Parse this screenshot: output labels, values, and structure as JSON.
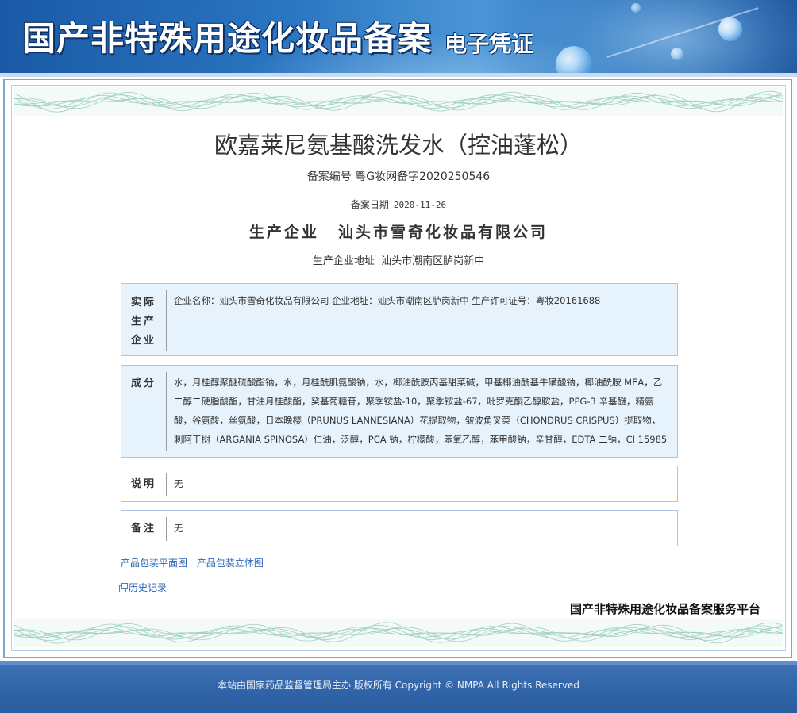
{
  "header": {
    "title": "国产非特殊用途化妆品备案",
    "subtitle": "电子凭证"
  },
  "product": {
    "name": "欧嘉莱尼氨基酸洗发水（控油蓬松）",
    "reg_no_label": "备案编号",
    "reg_no_value": "粤G妆网备字2020250546",
    "reg_date_label": "备案日期",
    "reg_date_value": "2020-11-26",
    "maker_label": "生产企业",
    "maker_value": "汕头市雪奇化妆品有限公司",
    "maker_addr_label": "生产企业地址",
    "maker_addr_value": "汕头市潮南区胪岗新中"
  },
  "sections": {
    "actual_maker": {
      "label_lines": [
        "实际",
        "生产",
        "企业"
      ],
      "value": "企业名称：汕头市雪奇化妆品有限公司   企业地址：汕头市潮南区胪岗新中   生产许可证号：粤妆20161688"
    },
    "ingredients": {
      "label": "成分",
      "value": "水，月桂醇聚醚硫酸酯钠，水，月桂酰肌氨酸钠，水，椰油酰胺丙基甜菜碱，甲基椰油酰基牛磺酸钠，椰油酰胺 MEA，乙二醇二硬脂酸酯，甘油月桂酸酯，癸基葡糖苷，聚季铵盐-10，聚季铵盐-67，吡罗克酮乙醇胺盐，PPG-3 辛基醚，精氨酸，谷氨酸，丝氨酸，日本晚樱（PRUNUS LANNESIANA）花提取物，皱波角叉菜（CHONDRUS CRISPUS）提取物，刺阿干树（ARGANIA SPINOSA）仁油，泛醇，PCA 钠，柠檬酸，苯氧乙醇，苯甲酸钠，辛甘醇，EDTA 二钠，CI 15985"
    },
    "notes": {
      "label": "说明",
      "value": "无"
    },
    "remarks": {
      "label": "备注",
      "value": "无"
    }
  },
  "links": {
    "flat_image": "产品包装平面图",
    "3d_image": "产品包装立体图",
    "history": "历史记录"
  },
  "platform_name": "国产非特殊用途化妆品备案服务平台",
  "footer": {
    "text": "本站由国家药品监督管理局主办 版权所有 Copyright © NMPA All Rights Reserved"
  },
  "colors": {
    "banner_blue": "#2a74c0",
    "box_blue_bg": "#e6f3fc",
    "link_blue": "#2a64b8",
    "footer_blue": "#2f62a6"
  }
}
